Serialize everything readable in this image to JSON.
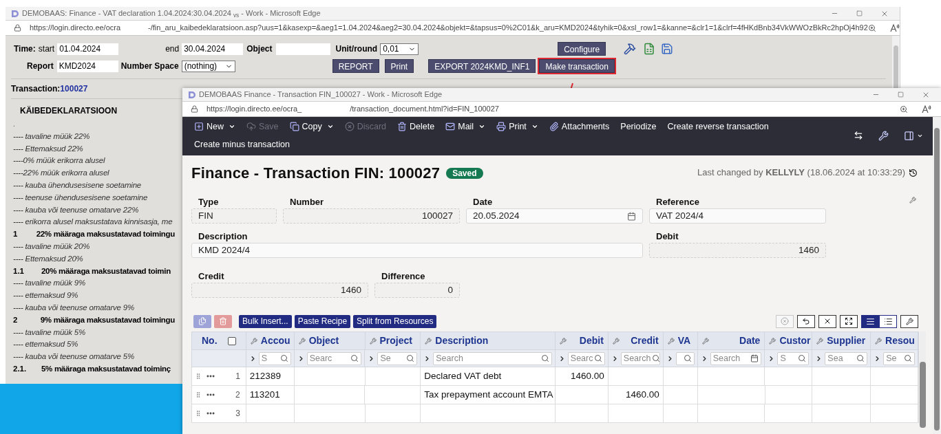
{
  "back_window": {
    "title": "DEMOBAAS: Finance - VAT declaration 1.04.2024:30.04.2024 $_{vs}$ - Work - Microsoft Edge",
    "url_left": "https://login.directo.ee/ocra",
    "url_right": "-/fin_aru_kaibedeklaratsioon.asp?uus=1&kasexp=&aeg1=1.04.2024&aeg2=30.04.2024&objekt=&tapsus=0%2C01&k_aru=KMD2024&tyhik=0&xsl_row1=&kanne=&clr1=1&clrf=4fHKdBnb34VkWWOzBkRc2hpOj4h92",
    "time_label": "Time:",
    "start_label": "start",
    "start_value": "01.04.2024",
    "end_label": "end",
    "end_value": "30.04.2024",
    "object_label": "Object",
    "unit_label": "Unit/round",
    "unit_value": "0,01",
    "report_label": "Report",
    "report_value": "KMD2024",
    "number_space_label": "Number Space",
    "number_space_value": "(nothing)",
    "configure_button": "Configure",
    "buttons": [
      {
        "label": "REPORT",
        "highlighted": false
      },
      {
        "label": "Print",
        "highlighted": false
      },
      {
        "label": "EXPORT 2024KMD_INF1",
        "highlighted": false
      },
      {
        "label": "Make transaction",
        "highlighted": true
      }
    ],
    "transaction_label": "Transaction:",
    "transaction_link": "100027",
    "report_title": "KÄIBEDEKLARATSIOON",
    "lines": [
      {
        "kind": "dot",
        "text": "."
      },
      {
        "kind": "line",
        "text": "---- tavaline müük 22%"
      },
      {
        "kind": "line",
        "text": "---- Ettemaksud 22%"
      },
      {
        "kind": "line",
        "text": "----0% müük erikorra alusel"
      },
      {
        "kind": "line",
        "text": "----22% müük erikorra alusel"
      },
      {
        "kind": "line",
        "text": "---- kauba ühendusesisene soetamine"
      },
      {
        "kind": "line",
        "text": "---- teenuse ühendusesisene soetamine"
      },
      {
        "kind": "line",
        "text": "---- kauba või teenuse omatarve 22%"
      },
      {
        "kind": "line",
        "text": "---- erikorra alusel maksustatava kinnisasja, me"
      },
      {
        "kind": "total",
        "number": "1",
        "text": "22% määraga maksustatavad toimingu"
      },
      {
        "kind": "line",
        "text": "---- tavaline müük 20%"
      },
      {
        "kind": "line",
        "text": "---- Ettemaksud 20%"
      },
      {
        "kind": "total",
        "number": "1.1",
        "text": "20% määraga maksustatavad toimin"
      },
      {
        "kind": "line",
        "text": "---- tavaline müük 9%"
      },
      {
        "kind": "line",
        "text": "---- ettemaksud 9%"
      },
      {
        "kind": "line",
        "text": "---- kauba või teenuse omatarve 9%"
      },
      {
        "kind": "total",
        "number": "2",
        "text": "9% määraga maksustatavad toimingu"
      },
      {
        "kind": "line",
        "text": "---- tavaline müük 5%"
      },
      {
        "kind": "line",
        "text": "---- ettemaksud 5%"
      },
      {
        "kind": "line",
        "text": "---- kauba või teenuse omatarve 5%"
      },
      {
        "kind": "total",
        "number": "2.1.",
        "text": "5% määraga maksustatavad toiminç"
      }
    ]
  },
  "transaction_window": {
    "title": "DEMOBAAS Finance - Transaction FIN_100027 - Work - Microsoft Edge",
    "url_left": "https://login.directo.ee/ocra_",
    "url_right": "/transaction_document.html?id=FIN_100027",
    "toolbar": [
      {
        "label": "New",
        "disabled": false,
        "dropdown": true
      },
      {
        "label": "Save",
        "disabled": true,
        "dropdown": false
      },
      {
        "label": "Copy",
        "disabled": false,
        "dropdown": true
      },
      {
        "label": "Discard",
        "disabled": true,
        "dropdown": false
      },
      {
        "label": "Delete",
        "disabled": false,
        "dropdown": false
      },
      {
        "label": "Mail",
        "disabled": false,
        "dropdown": true
      },
      {
        "label": "Print",
        "disabled": false,
        "dropdown": true
      },
      {
        "label": "Attachments",
        "disabled": false,
        "dropdown": false
      },
      {
        "label": "Periodize",
        "disabled": false,
        "dropdown": false
      },
      {
        "label": "Create reverse transaction",
        "disabled": false,
        "dropdown": false
      },
      {
        "label": "Create minus transaction",
        "disabled": false,
        "dropdown": false
      }
    ],
    "heading": "Finance - Transaction FIN: 100027",
    "status": "Saved",
    "last_changed": "Last changed by **KELLYLY** (18.06.2024 at 10:33:29)",
    "fields": {
      "type": {
        "label": "Type",
        "value": "FIN"
      },
      "number": {
        "label": "Number",
        "value": "100027"
      },
      "date": {
        "label": "Date",
        "value": "20.05.2024"
      },
      "reference": {
        "label": "Reference",
        "value": "VAT 2024/4"
      },
      "description": {
        "label": "Description",
        "value": "KMD 2024/4"
      },
      "debit": {
        "label": "Debit",
        "value": "1460"
      },
      "credit": {
        "label": "Credit",
        "value": "1460"
      },
      "difference": {
        "label": "Difference",
        "value": "0"
      }
    },
    "grid_buttons": [
      "Bulk Insert...",
      "Paste Recipe",
      "Split from Resources"
    ],
    "view_buttons": [
      {
        "selected": true
      },
      {
        "selected": false
      }
    ],
    "grid": {
      "no_label": "No.",
      "select_all_checked": false,
      "columns": [
        {
          "label": "Accou",
          "filter": "S"
        },
        {
          "label": "Object",
          "filter": "Searc"
        },
        {
          "label": "Project",
          "filter": "Se"
        },
        {
          "label": "Description",
          "filter": "Search"
        },
        {
          "label": "Debit",
          "filter": "Searc"
        },
        {
          "label": "Credit",
          "filter": "Search"
        },
        {
          "label": "VA"
        },
        {
          "label": "Date",
          "filter": "Search"
        },
        {
          "label": "Custor",
          "filter": "S"
        },
        {
          "label": "Supplier",
          "filter": "Sea"
        },
        {
          "label": "Resou",
          "filter": "Se"
        }
      ],
      "rows": [
        {
          "no": "1",
          "cells": [
            "212389",
            "",
            "",
            "Declared VAT debt",
            "1460.00",
            "",
            "",
            "",
            "",
            "",
            ""
          ]
        },
        {
          "no": "2",
          "cells": [
            "113201",
            "",
            "",
            "Tax prepayment account EMTA",
            "",
            "1460.00",
            "",
            "",
            "",
            "",
            ""
          ]
        },
        {
          "no": "3",
          "cells": [
            "",
            "",
            "",
            "",
            "",
            "",
            "",
            "",
            "",
            "",
            ""
          ]
        }
      ]
    }
  }
}
